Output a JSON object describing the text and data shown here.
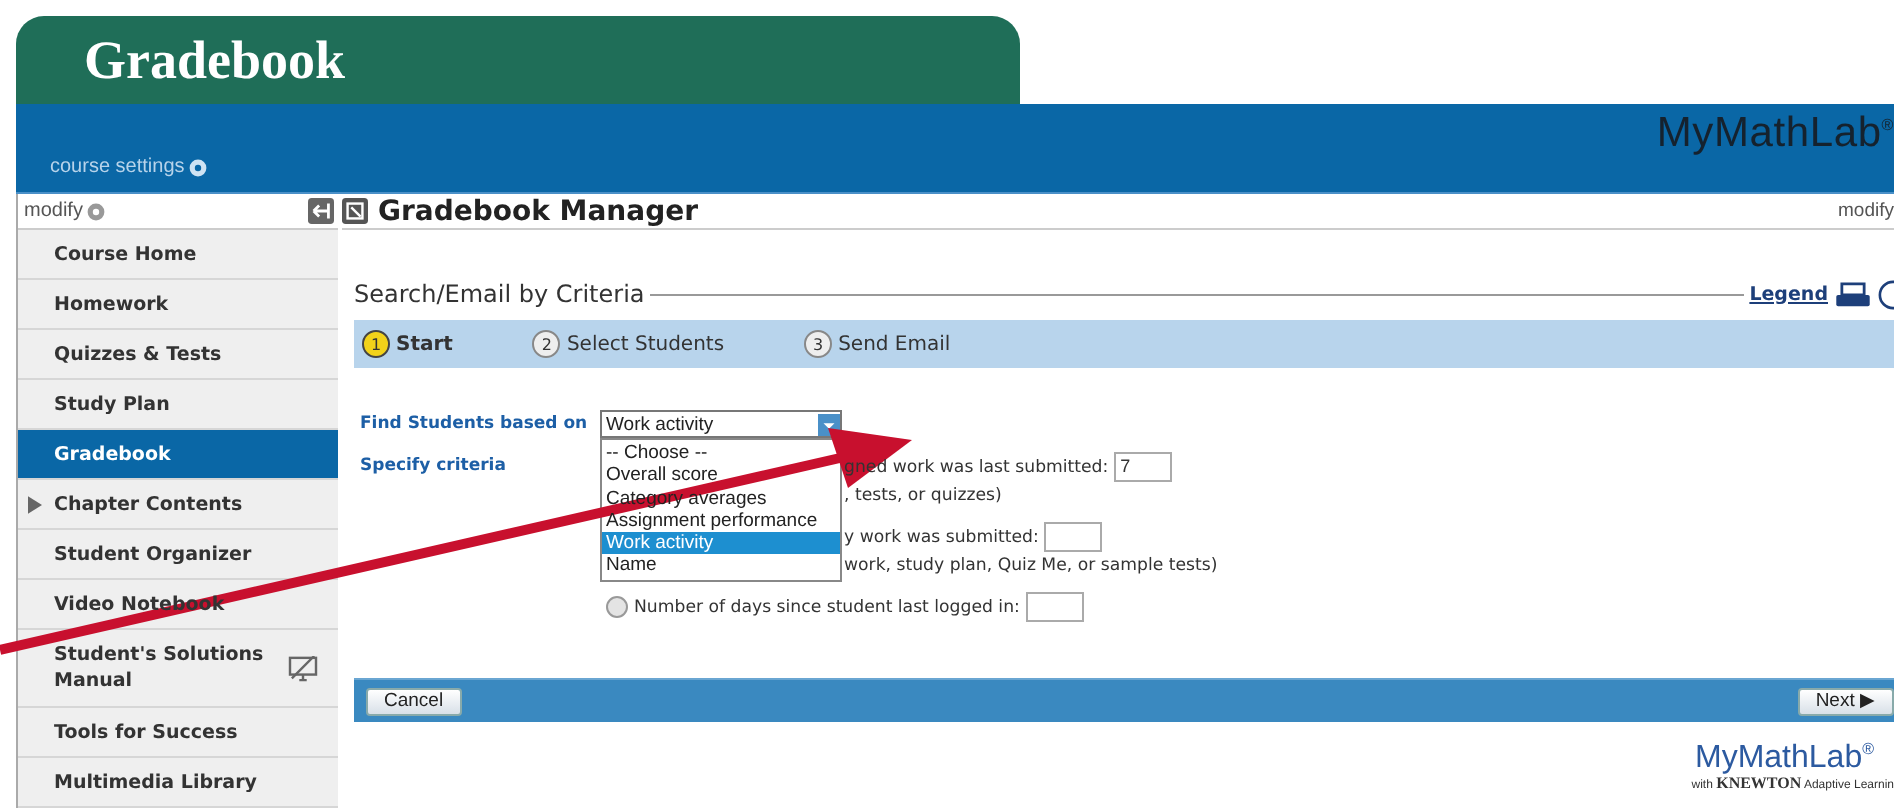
{
  "page_tab": {
    "title": "Gradebook"
  },
  "header": {
    "course_settings": "course settings",
    "logo": {
      "brand": "MyMathLab",
      "mark": "®"
    }
  },
  "sidebar": {
    "modify": "modify",
    "items": [
      {
        "kind": "plain",
        "label": "Course Home",
        "selected": false
      },
      {
        "kind": "plain",
        "label": "Homework",
        "selected": false
      },
      {
        "kind": "plain",
        "label": "Quizzes & Tests",
        "selected": false
      },
      {
        "kind": "plain",
        "label": "Study Plan",
        "selected": false
      },
      {
        "kind": "plain",
        "label": "Gradebook",
        "selected": true
      },
      {
        "kind": "expandable",
        "label": "Chapter Contents",
        "selected": false
      },
      {
        "kind": "plain",
        "label": "Student Organizer",
        "selected": false
      },
      {
        "kind": "plain",
        "label": "Video Notebook",
        "selected": false
      },
      {
        "kind": "monitor",
        "label": "Student's Solutions Manual",
        "selected": false
      },
      {
        "kind": "plain",
        "label": "Tools for Success",
        "selected": false
      },
      {
        "kind": "plain",
        "label": "Multimedia Library",
        "selected": false
      }
    ]
  },
  "main": {
    "title": "Gradebook Manager",
    "modify": "modify",
    "section_title": "Search/Email by Criteria",
    "legend_link": "Legend",
    "steps": [
      {
        "number": "1",
        "label": "Start",
        "selected": true
      },
      {
        "number": "2",
        "label": "Select Students",
        "selected": false
      },
      {
        "number": "3",
        "label": "Send Email",
        "selected": false
      }
    ],
    "find_label": "Find Students based on",
    "criteria_label": "Specify criteria",
    "select": {
      "value": "Work activity",
      "expanded": true,
      "options": [
        {
          "label": "-- Choose --",
          "selected": false
        },
        {
          "label": "Overall score",
          "selected": false
        },
        {
          "label": "Category averages",
          "selected": false
        },
        {
          "label": "Assignment performance",
          "selected": false
        },
        {
          "label": "Work activity",
          "selected": true
        },
        {
          "label": "Name",
          "selected": false
        }
      ]
    },
    "criteria": [
      {
        "kind": "partial",
        "text": "gned work was last submitted:",
        "value": "7",
        "note": ", tests, or quizzes)"
      },
      {
        "kind": "partial",
        "text": "y work was submitted:",
        "note": "work, study plan, Quiz Me, or sample tests)"
      },
      {
        "kind": "radio",
        "selected": false,
        "text": "Number of days since student last logged in:"
      }
    ],
    "buttons": {
      "cancel": "Cancel",
      "next": "Next",
      "next_glyph": "▶"
    }
  },
  "footer_logo": {
    "brand_a": "My",
    "brand_b": "Math",
    "brand_c": "Lab",
    "mark": "®",
    "tagline_a": "with ",
    "tagline_b": "KNEWTON",
    "tagline_c": " Adaptive Learnin"
  }
}
